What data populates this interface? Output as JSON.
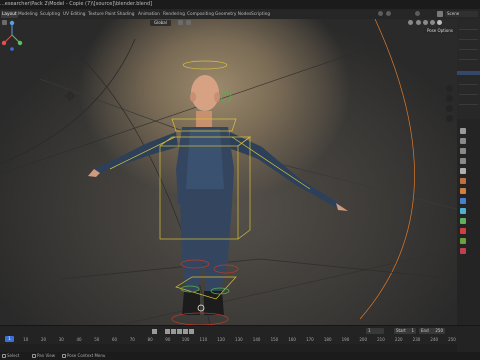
{
  "window": {
    "title": "...esearcher\\Pack 2\\Model - Copie (7)\\[source]\\blender.blend]"
  },
  "workspace_tabs": [
    {
      "label": "Layout",
      "active": true
    },
    {
      "label": "Modeling",
      "active": false
    },
    {
      "label": "Sculpting",
      "active": false
    },
    {
      "label": "UV Editing",
      "active": false
    },
    {
      "label": "Texture Paint",
      "active": false
    },
    {
      "label": "Shading",
      "active": false
    },
    {
      "label": "Animation",
      "active": false
    },
    {
      "label": "Rendering",
      "active": false
    },
    {
      "label": "Compositing",
      "active": false
    },
    {
      "label": "Geometry Nodes",
      "active": false
    },
    {
      "label": "Scripting",
      "active": false
    }
  ],
  "scene": {
    "name": "Scene"
  },
  "viewport": {
    "mode": "Global",
    "pose_options": "Pose Options",
    "gizmo_icon": "navigation-gizmo-icon"
  },
  "timeline": {
    "current_frame": "1",
    "start_label": "Start",
    "start": "1",
    "end_label": "End",
    "end": "250",
    "ticks": [
      "0",
      "10",
      "20",
      "30",
      "40",
      "50",
      "60",
      "70",
      "80",
      "90",
      "100",
      "110",
      "120",
      "130",
      "140",
      "150",
      "160",
      "170",
      "180",
      "190",
      "200",
      "210",
      "220",
      "230",
      "240",
      "250"
    ]
  },
  "status_bar": {
    "select_hint": "Select",
    "pan_hint": "Pan View",
    "context_menu_hint": "Pose Context Menu"
  },
  "colors": {
    "accent": "#3d6fd8",
    "bone_yellow": "#d8c23a",
    "outline_orange": "#e07a2a"
  }
}
